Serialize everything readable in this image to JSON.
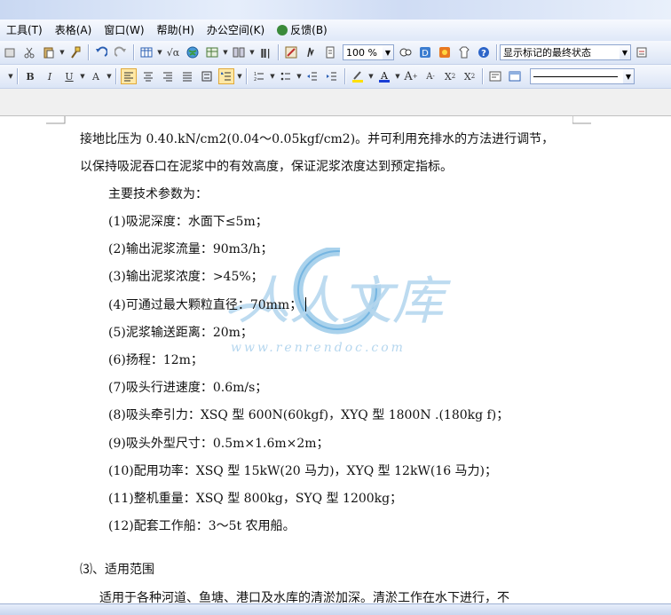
{
  "menu": {
    "items": [
      "工具(T)",
      "表格(A)",
      "窗口(W)",
      "帮助(H)",
      "办公空间(K)",
      "反馈(B)"
    ]
  },
  "toolbar": {
    "zoom": "100 %",
    "markup_state": "显示标记的最终状态"
  },
  "document": {
    "lines": [
      "接地比压为 0.40.kN/cm2(0.04～0.05kgf/cm2)。并可利用充排水的方法进行调节，",
      "以保持吸泥吞口在泥浆中的有效高度，保证泥浆浓度达到预定指标。",
      "主要技术参数为：",
      "(1)吸泥深度：水面下≤5m；",
      "(2)输出泥浆流量：90m3/h；",
      "(3)输出泥浆浓度：>45%；",
      "(4)可通过最大颗粒直径：70mm；",
      "(5)泥浆输送距离：20m；",
      "(6)扬程：12m；",
      "(7)吸头行进速度：0.6m/s；",
      "(8)吸头牵引力：XSQ 型 600N(60kgf)，XYQ 型 1800N .(180kg f)；",
      "(9)吸头外型尺寸：0.5m×1.6m×2m；",
      "(10)配用功率：XSQ 型 15kW(20 马力)，XYQ 型 12kW(16 马力)；",
      "(11)整机重量：XSQ 型 800kg，SYQ 型 1200kg；",
      "(12)配套工作船：3～5t 农用船。",
      "⑶、适用范围",
      "适用于各种河道、鱼塘、港口及水库的清淤加深。清淤工作在水下进行，不"
    ]
  },
  "watermark": {
    "text": "人人文库",
    "url": "www.renrendoc.com"
  }
}
